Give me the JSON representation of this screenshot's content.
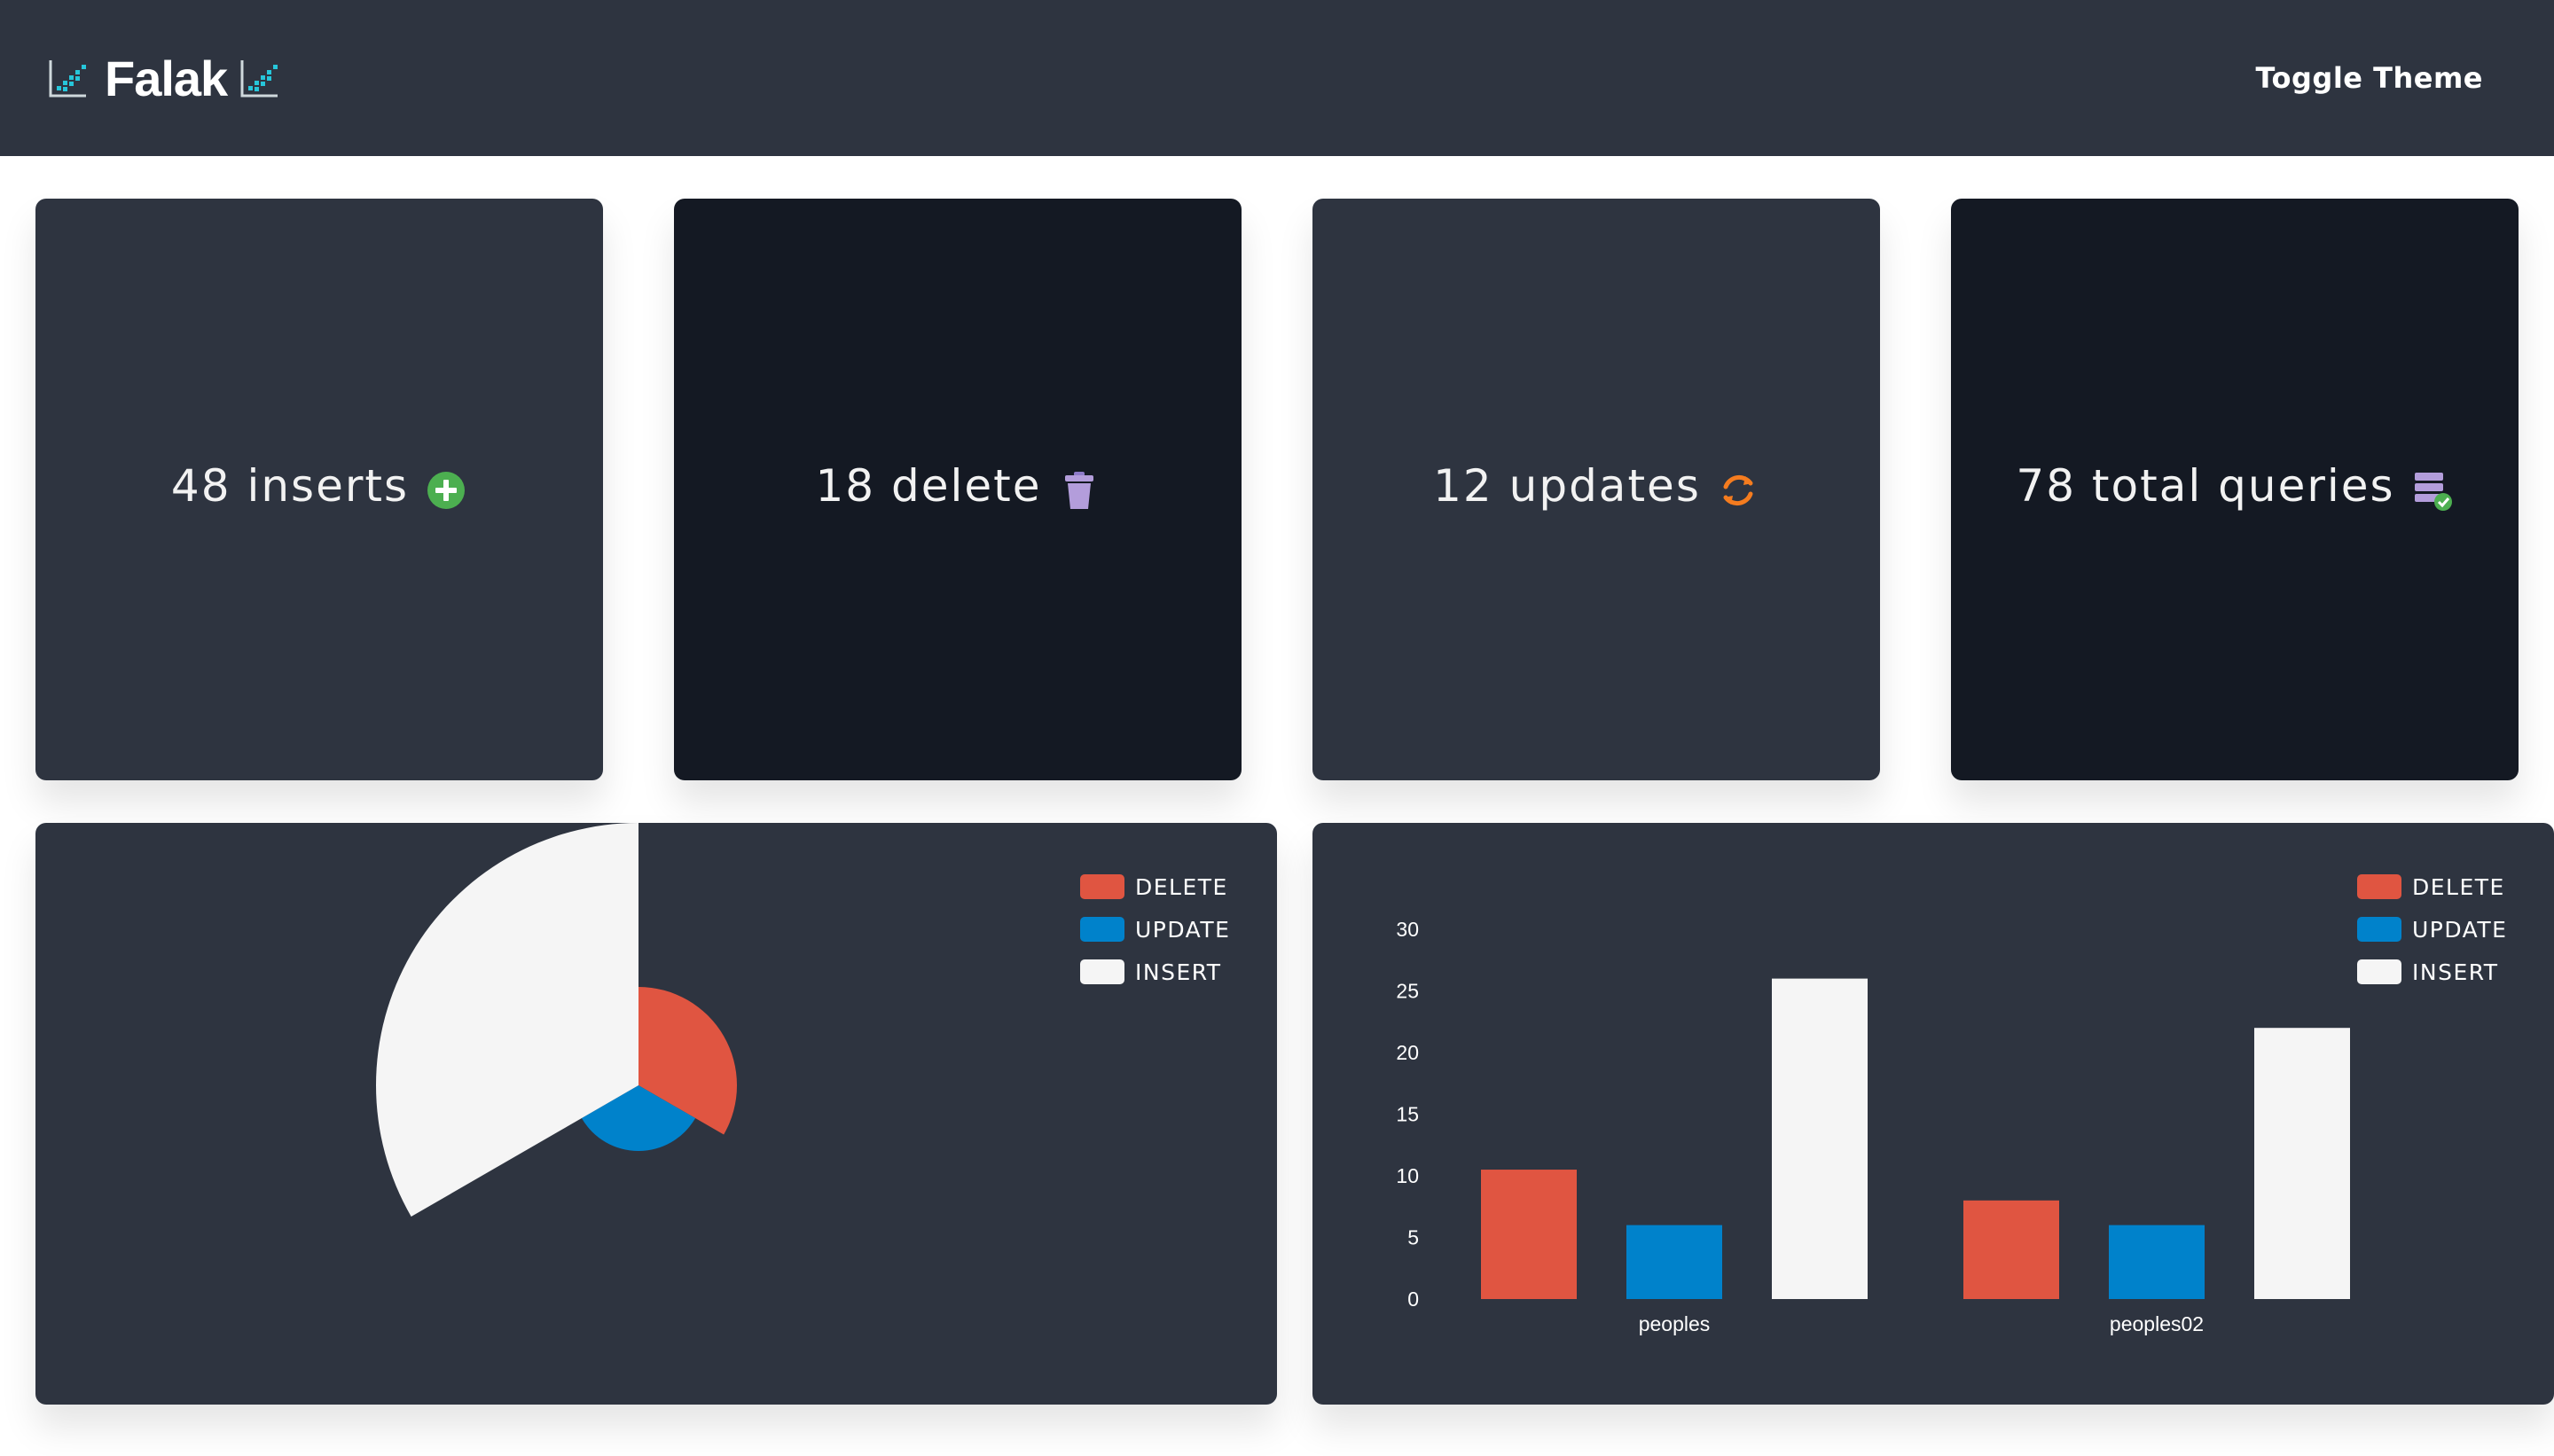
{
  "app": {
    "name": "Falak",
    "toggle_label": "Toggle Theme"
  },
  "stats": [
    {
      "count": "48",
      "label": "inserts",
      "icon": "plus-circle-icon",
      "icon_color": "#4caf50"
    },
    {
      "count": "18",
      "label": "delete",
      "icon": "trash-icon",
      "icon_color": "#b39ddb"
    },
    {
      "count": "12",
      "label": "updates",
      "icon": "refresh-icon",
      "icon_color": "#f57c1f"
    },
    {
      "count": "78",
      "label": "total queries",
      "icon": "database-check-icon",
      "icon_color": "#b39ddb"
    }
  ],
  "colors": {
    "delete": "#e05541",
    "update": "#0082cb",
    "insert": "#f5f5f5",
    "header_bg": "#2e3440",
    "card_light": "#2e3440",
    "card_dark": "#141923"
  },
  "chart_data": [
    {
      "type": "pie",
      "variant": "polar-area",
      "labels": [
        "DELETE",
        "UPDATE",
        "INSERT"
      ],
      "values": [
        18,
        12,
        48
      ],
      "legend": "top-right"
    },
    {
      "type": "bar",
      "categories": [
        "peoples",
        "peoples02"
      ],
      "series": [
        {
          "name": "DELETE",
          "values": [
            10.5,
            8
          ]
        },
        {
          "name": "UPDATE",
          "values": [
            6,
            6
          ]
        },
        {
          "name": "INSERT",
          "values": [
            26,
            22
          ]
        }
      ],
      "ylim": [
        0,
        30
      ],
      "yticks": [
        0,
        5,
        10,
        15,
        20,
        25,
        30
      ],
      "grid": false,
      "legend": "top-right"
    }
  ]
}
